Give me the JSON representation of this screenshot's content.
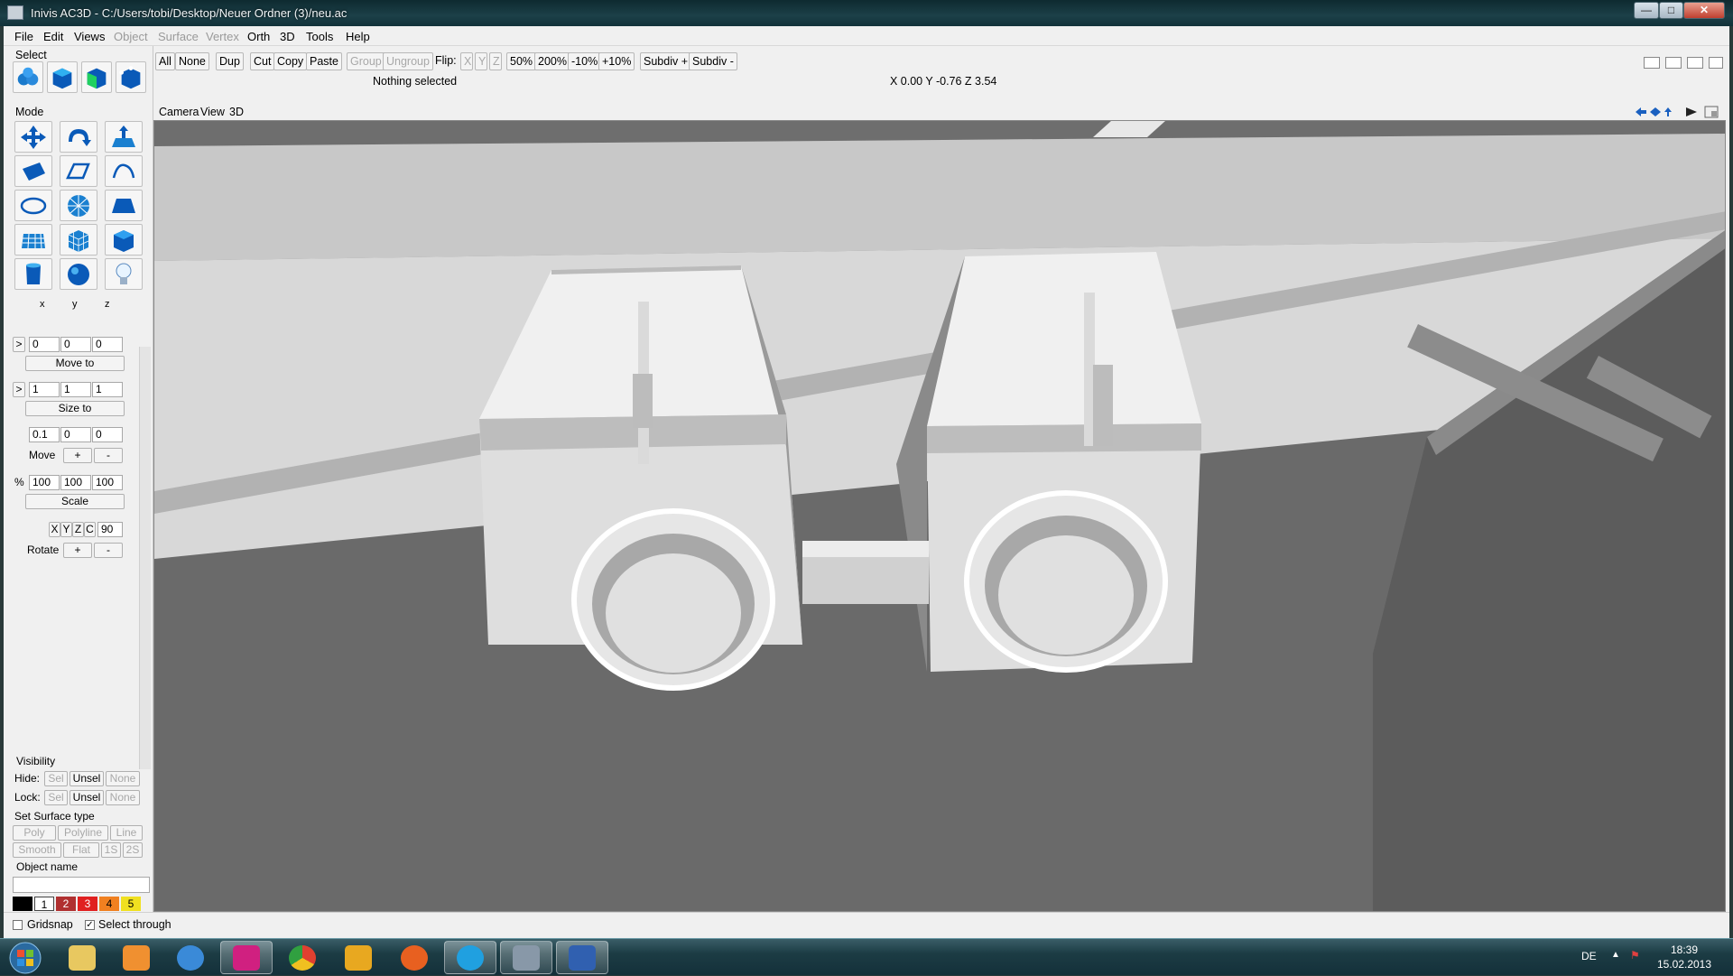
{
  "window": {
    "title": "Inivis AC3D - C:/Users/tobi/Desktop/Neuer Ordner (3)/neu.ac",
    "min": "—",
    "max": "□",
    "close": "✕"
  },
  "menu": {
    "items": [
      {
        "label": "File",
        "enabled": true
      },
      {
        "label": "Edit",
        "enabled": true
      },
      {
        "label": "Views",
        "enabled": true
      },
      {
        "label": "Object",
        "enabled": false
      },
      {
        "label": "Surface",
        "enabled": false
      },
      {
        "label": "Vertex",
        "enabled": false
      },
      {
        "label": "Orth",
        "enabled": true
      },
      {
        "label": "3D",
        "enabled": true
      },
      {
        "label": "Tools",
        "enabled": true
      },
      {
        "label": "Help",
        "enabled": true
      }
    ]
  },
  "toolbar": {
    "all": "All",
    "none": "None",
    "dup": "Dup",
    "cut": "Cut",
    "copy": "Copy",
    "paste": "Paste",
    "group": "Group",
    "ungroup": "Ungroup",
    "flip_label": "Flip:",
    "flip_x": "X",
    "flip_y": "Y",
    "flip_z": "Z",
    "p50": "50%",
    "p200": "200%",
    "m10": "-10%",
    "p10": "+10%",
    "subdiv_plus": "Subdiv +",
    "subdiv_minus": "Subdiv -"
  },
  "status": {
    "selection": "Nothing selected",
    "coords": "X 0.00 Y -0.76 Z 3.54"
  },
  "left": {
    "select_label": "Select",
    "mode_label": "Mode",
    "axes": {
      "x": "x",
      "y": "y",
      "z": "z"
    },
    "pos": {
      "arrow": ">",
      "x": "0",
      "y": "0",
      "z": "0",
      "button": "Move to"
    },
    "size": {
      "arrow": ">",
      "x": "1",
      "y": "1",
      "z": "1",
      "button": "Size to"
    },
    "move": {
      "x": "0.1",
      "y": "0",
      "z": "0",
      "label": "Move",
      "plus": "+",
      "minus": "-"
    },
    "scale": {
      "pct": "%",
      "x": "100",
      "y": "100",
      "z": "100",
      "button": "Scale"
    },
    "rotate": {
      "bx": "X",
      "by": "Y",
      "bz": "Z",
      "bc": "C",
      "angle": "90",
      "label": "Rotate",
      "plus": "+",
      "minus": "-"
    },
    "visibility": {
      "label": "Visibility",
      "hide": "Hide:",
      "lock": "Lock:",
      "sel": "Sel",
      "unsel": "Unsel",
      "none": "None"
    },
    "surface": {
      "label": "Set Surface type",
      "poly": "Poly",
      "polyline": "Polyline",
      "line": "Line",
      "smooth": "Smooth",
      "flat": "Flat",
      "s1": "1S",
      "s2": "2S"
    },
    "object_name": {
      "label": "Object name",
      "value": ""
    },
    "swatches": [
      {
        "label": "",
        "color": "#000000"
      },
      {
        "label": "1",
        "color": "#ffffff"
      },
      {
        "label": "2",
        "color": "#b03030"
      },
      {
        "label": "3",
        "color": "#e02020"
      },
      {
        "label": "4",
        "color": "#f08020"
      },
      {
        "label": "5",
        "color": "#f0e020"
      }
    ]
  },
  "viewport": {
    "header_camera": "Camera",
    "header_view": "View",
    "header_3d": "3D"
  },
  "bottom": {
    "gridsnap": "Gridsnap",
    "gridsnap_checked": false,
    "select_through": "Select through",
    "select_through_checked": true
  },
  "taskbar": {
    "lang": "DE",
    "time": "18:39",
    "date": "15.02.2013"
  }
}
